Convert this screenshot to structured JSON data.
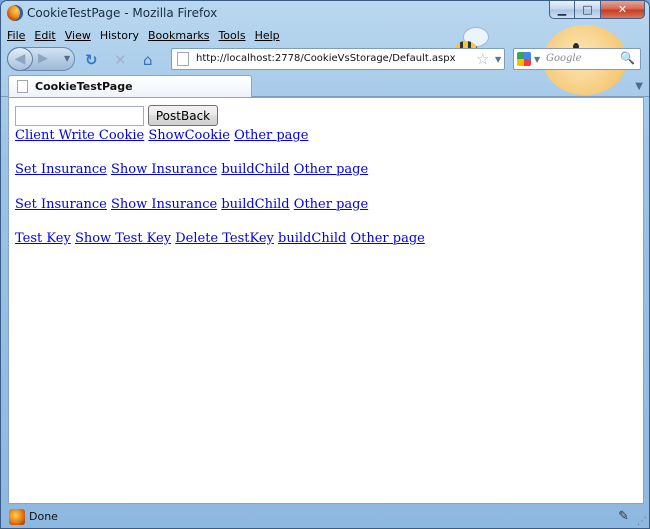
{
  "window": {
    "title": "CookieTestPage - Mozilla Firefox"
  },
  "menu": [
    {
      "label": "File"
    },
    {
      "label": "Edit"
    },
    {
      "label": "View"
    },
    {
      "label": "History"
    },
    {
      "label": "Bookmarks"
    },
    {
      "label": "Tools"
    },
    {
      "label": "Help"
    }
  ],
  "nav": {
    "url": "http://localhost:2778/CookieVsStorage/Default.aspx",
    "search_placeholder": "Google"
  },
  "tab": {
    "label": "CookieTestPage"
  },
  "form": {
    "input_value": "",
    "postback_label": "PostBack"
  },
  "link_rows": [
    [
      "Client Write Cookie",
      "ShowCookie",
      "Other page"
    ],
    [
      "Set Insurance",
      "Show Insurance",
      "buildChild",
      "Other page"
    ],
    [
      "Set Insurance",
      "Show Insurance",
      "buildChild",
      "Other page"
    ],
    [
      "Test Key",
      "Show Test Key",
      "Delete TestKey",
      "buildChild",
      "Other page"
    ]
  ],
  "status": {
    "text": "Done"
  },
  "colors": {
    "link": "#0000ee",
    "chrome": "#9cc3e6"
  }
}
